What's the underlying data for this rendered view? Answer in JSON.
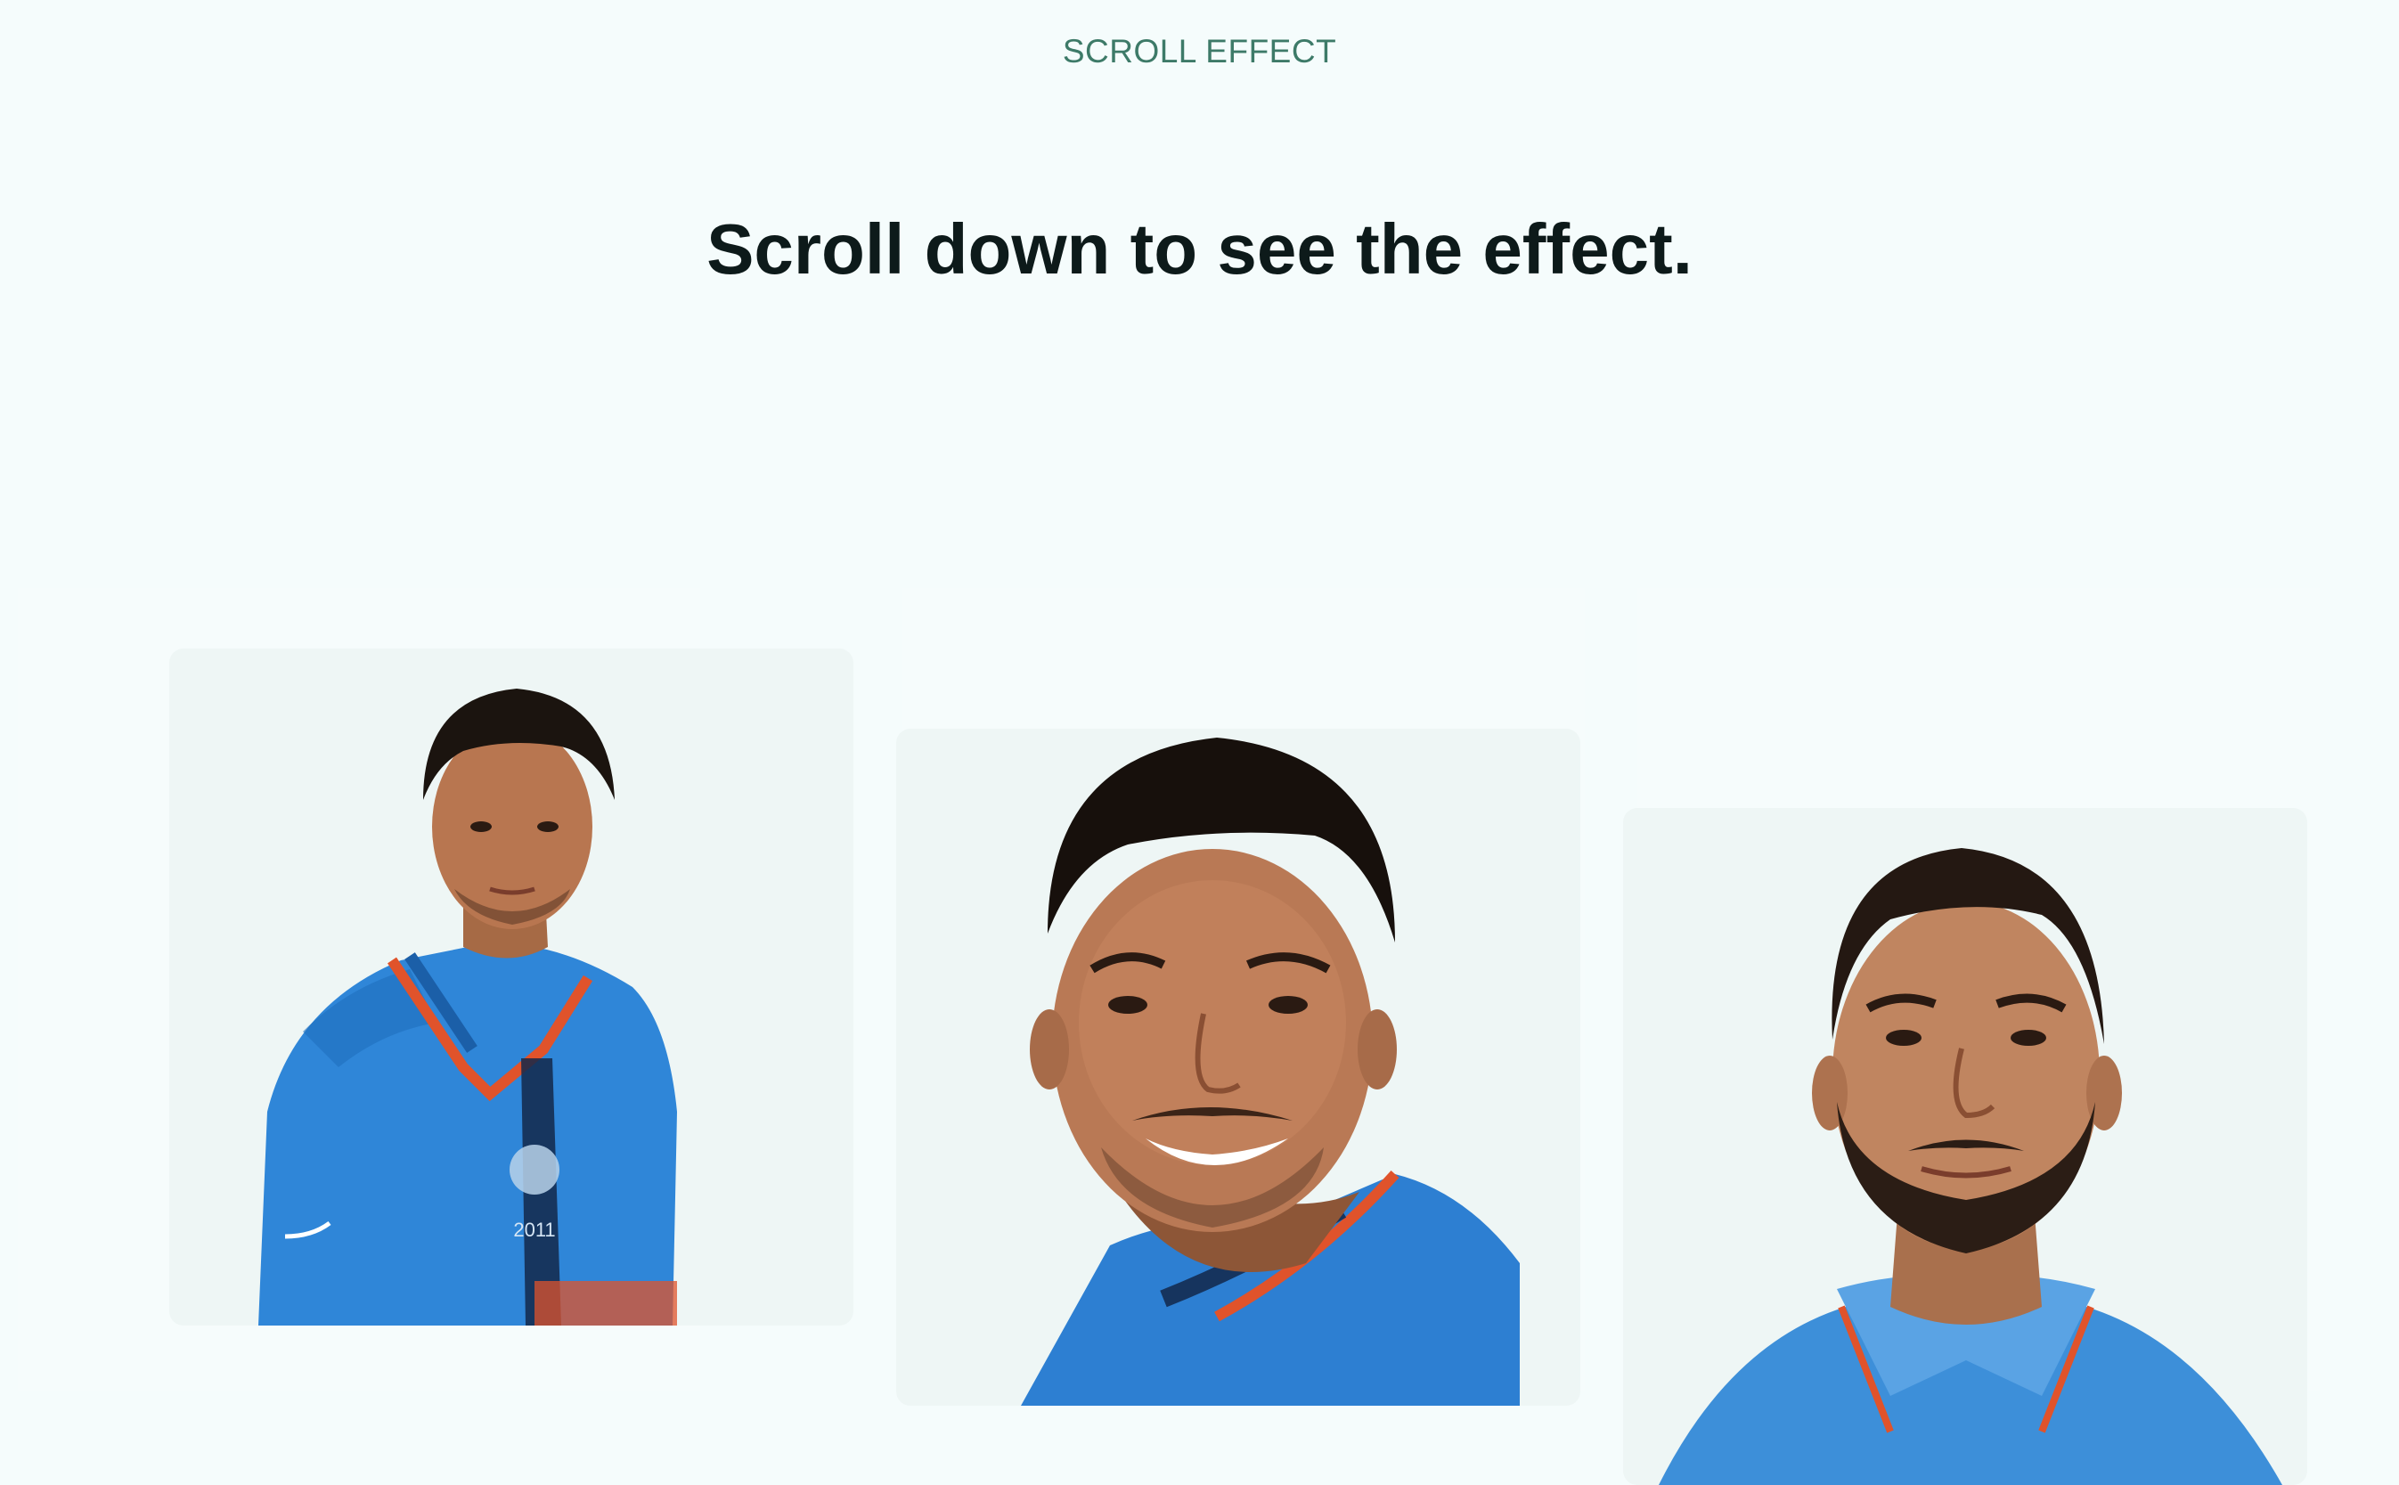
{
  "header": {
    "eyebrow": "SCROLL EFFECT",
    "title": "Scroll down to see the effect."
  },
  "cards": [
    {
      "image": "portrait-player-1",
      "jersey_year": "2011",
      "colors": {
        "jersey": "#2f86d8",
        "trim": "#e0532b"
      }
    },
    {
      "image": "portrait-player-2",
      "colors": {
        "jersey": "#2d7fd2",
        "trim": "#e0532b"
      }
    },
    {
      "image": "portrait-player-3",
      "colors": {
        "jersey": "#3d8fd9",
        "trim": "#e0532b"
      }
    }
  ]
}
